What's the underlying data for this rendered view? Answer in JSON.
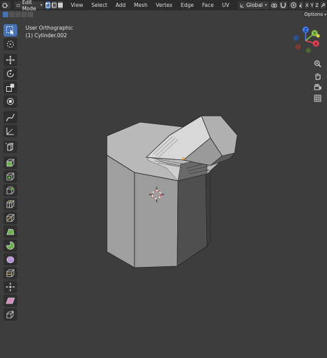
{
  "header": {
    "mode": "Edit Mode",
    "menus": [
      "View",
      "Select",
      "Add",
      "Mesh",
      "Vertex",
      "Edge",
      "Face",
      "UV"
    ],
    "orientation": "Global",
    "axes": [
      "X",
      "Y",
      "Z"
    ],
    "options": "Options"
  },
  "viewport": {
    "view_name": "User Orthographic",
    "object_name": "(1) Cylinder.002"
  },
  "gizmo": {
    "x": "X",
    "y": "Y",
    "z": "Z"
  },
  "colors": {
    "accent": "#4772b3",
    "background": "#3d3d3d",
    "header": "#2b2b2b",
    "axis_x": "#e74556",
    "axis_y": "#8bc34a",
    "axis_z": "#3c7ff2"
  },
  "tools": [
    "select-box",
    "cursor",
    "move",
    "rotate",
    "scale",
    "transform",
    "annotate",
    "measure",
    "add-cube",
    "extrude-region",
    "inset-faces",
    "bevel",
    "loop-cut",
    "knife",
    "poly-build",
    "spin",
    "smooth",
    "edge-slide",
    "shrink-fatten",
    "shear",
    "rip-region"
  ]
}
